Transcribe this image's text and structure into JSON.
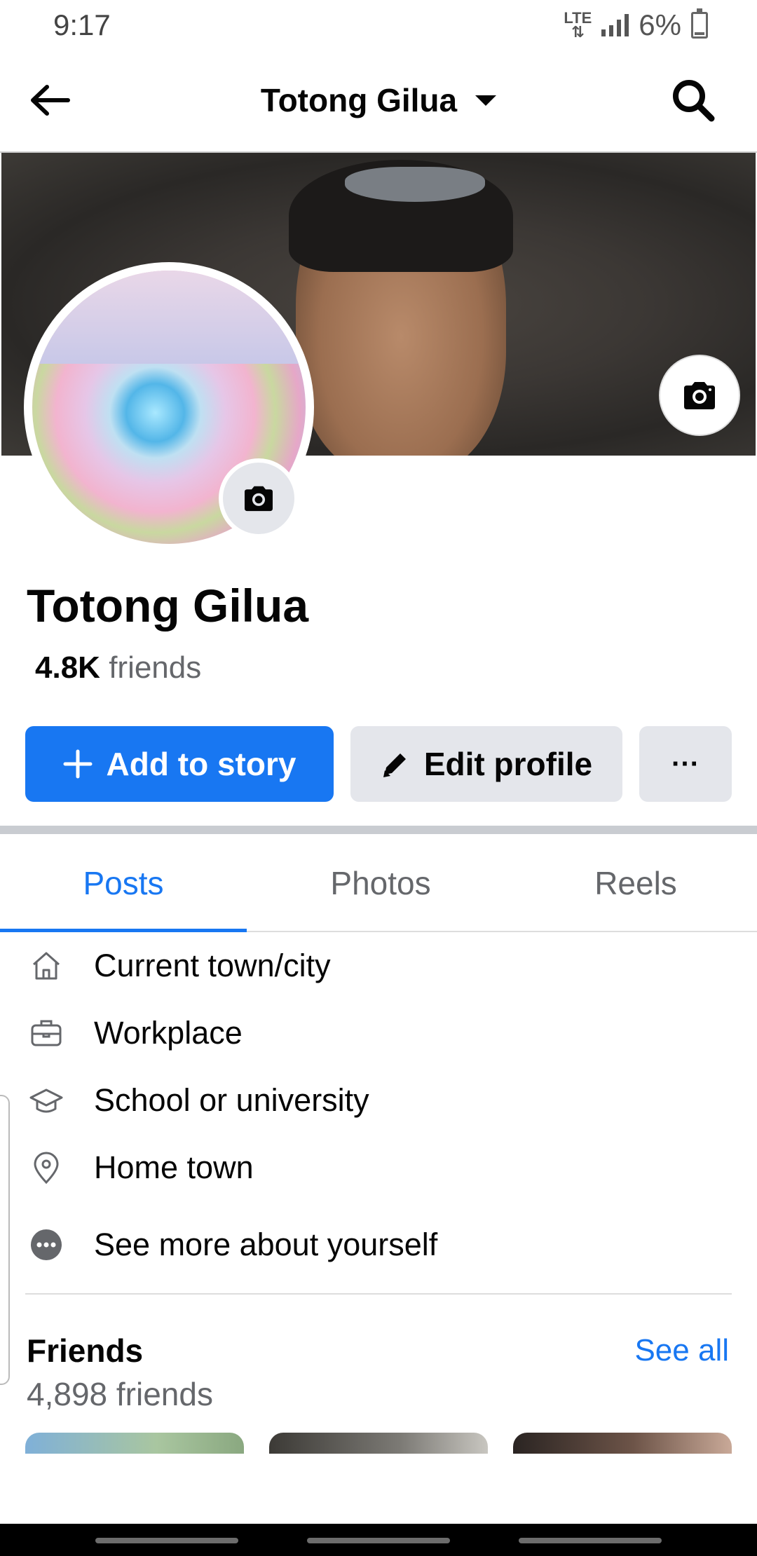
{
  "status_bar": {
    "time": "9:17",
    "network": "LTE",
    "battery": "6%"
  },
  "header": {
    "title": "Totong Gilua"
  },
  "profile": {
    "name": "Totong Gilua",
    "friends_count_short": "4.8K",
    "friends_label": "friends"
  },
  "actions": {
    "add_story": "Add to story",
    "edit_profile": "Edit profile",
    "more": "···"
  },
  "tabs": [
    {
      "label": "Posts",
      "active": true
    },
    {
      "label": "Photos",
      "active": false
    },
    {
      "label": "Reels",
      "active": false
    }
  ],
  "details": [
    {
      "icon": "home-icon",
      "label": "Current town/city"
    },
    {
      "icon": "briefcase-icon",
      "label": "Workplace"
    },
    {
      "icon": "graduation-cap-icon",
      "label": "School or university"
    },
    {
      "icon": "location-pin-icon",
      "label": "Home town"
    },
    {
      "icon": "more-dots-icon",
      "label": "See more about yourself"
    }
  ],
  "friends": {
    "title": "Friends",
    "see_all": "See all",
    "count_text": "4,898 friends"
  },
  "colors": {
    "accent": "#1877f2",
    "button_gray": "#e4e6eb",
    "secondary_text": "#65676b"
  }
}
